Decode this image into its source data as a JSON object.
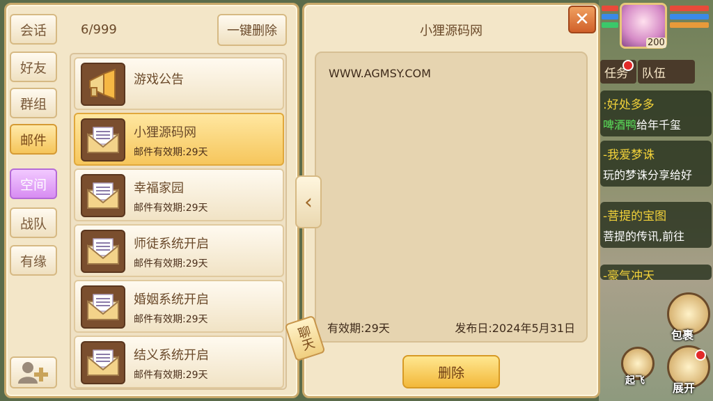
{
  "sidebar": {
    "tabs": [
      {
        "label": "会话"
      },
      {
        "label": "好友"
      },
      {
        "label": "群组"
      },
      {
        "label": "邮件"
      },
      {
        "label": "空间"
      },
      {
        "label": "战队"
      },
      {
        "label": "有缘"
      }
    ],
    "active_tab": "邮件",
    "add_friend_icon": "add-friend-icon"
  },
  "mail": {
    "count": "6/999",
    "delete_all_label": "一键删除",
    "items": [
      {
        "title": "游戏公告",
        "sub": "",
        "icon": "megaphone-icon"
      },
      {
        "title": "小狸源码网",
        "sub": "邮件有效期:29天",
        "icon": "envelope-icon"
      },
      {
        "title": "幸福家园",
        "sub": "邮件有效期:29天",
        "icon": "envelope-icon"
      },
      {
        "title": "师徒系统开启",
        "sub": "邮件有效期:29天",
        "icon": "envelope-icon"
      },
      {
        "title": "婚姻系统开启",
        "sub": "邮件有效期:29天",
        "icon": "envelope-icon"
      },
      {
        "title": "结义系统开启",
        "sub": "邮件有效期:29天",
        "icon": "envelope-icon"
      }
    ],
    "selected_index": 1
  },
  "detail": {
    "title": "小狸源码网",
    "body": "WWW.AGMSY.COM",
    "expiry": "有效期:29天",
    "date": "发布日:2024年5月31日",
    "delete_label": "删除",
    "close_icon": "close-icon"
  },
  "chat_tag": "聊天",
  "hud": {
    "level": "200",
    "tab_task": "任务",
    "tab_team": "队伍",
    "chat": [
      {
        "head": ":好处多多",
        "name": "啤酒鸭",
        "body": "给年千玺"
      },
      {
        "head": "-我爱梦诛",
        "name": "",
        "body": "玩的梦诛分享给好"
      },
      {
        "head": "-菩提的宝图",
        "name": "",
        "body": "菩提的传讯,前往"
      },
      {
        "head": "-豪气冲天",
        "name": "",
        "body": ""
      }
    ],
    "bag_label": "包裹",
    "fly_label": "起飞",
    "expand_label": "展开",
    "colors": {
      "hp": "#e84a3a",
      "mp": "#3a8ae8",
      "exp": "#3ac86a"
    }
  }
}
